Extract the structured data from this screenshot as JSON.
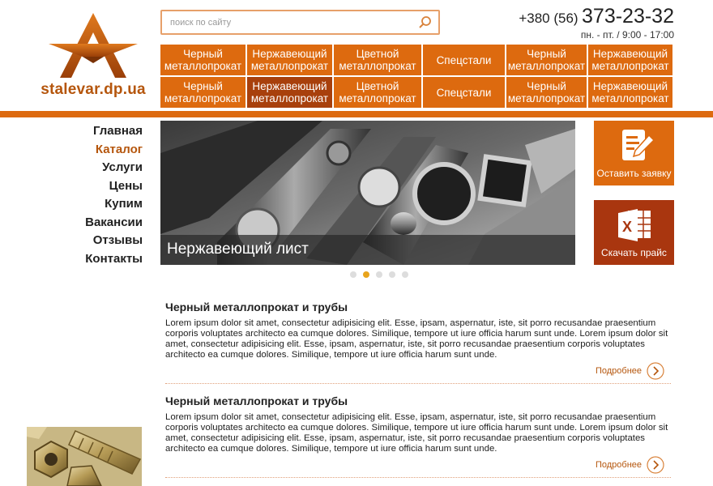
{
  "logo": {
    "text": "stalevar.dp.ua"
  },
  "search": {
    "placeholder": "поиск по сайту"
  },
  "contact": {
    "code": "+380 (56)",
    "number": "373-23-32",
    "hours": "пн. - пт. / 9:00 - 17:00"
  },
  "topnav": {
    "row1": [
      "Черный металлопрокат",
      "Нержавеющий металлопрокат",
      "Цветной металлопрокат",
      "Спецстали",
      "Черный металлопрокат",
      "Нержавеющий металлопрокат"
    ],
    "row2": [
      "Черный металлопрокат",
      "Нержавеющий металлопрокат",
      "Цветной металлопрокат",
      "Спецстали",
      "Черный металлопрокат",
      "Нержавеющий металлопрокат"
    ],
    "active_row2_index": 1
  },
  "sidenav": {
    "items": [
      "Главная",
      "Каталог",
      "Услуги",
      "Цены",
      "Купим",
      "Вакансии",
      "Отзывы",
      "Контакты"
    ],
    "active_index": 1
  },
  "slider": {
    "caption": "Нержавеющий лист",
    "slide_count": 5,
    "active_index": 1
  },
  "actions": {
    "request_label": "Оставить заявку",
    "price_label": "Скачать прайс"
  },
  "articles": [
    {
      "title": "Черный металлопрокат и трубы",
      "text": "Lorem ipsum dolor sit amet, consectetur adipisicing elit. Esse, ipsam, aspernatur, iste, sit porro recusandae praesentium corporis voluptates architecto ea cumque dolores. Similique, tempore ut iure officia harum sunt unde. Lorem ipsum dolor sit amet, consectetur adipisicing elit. Esse, ipsam, aspernatur, iste, sit porro recusandae praesentium corporis voluptates architecto ea cumque dolores. Similique, tempore ut iure officia harum sunt unde.",
      "more": "Подробнее"
    },
    {
      "title": "Черный металлопрокат и трубы",
      "text": "Lorem ipsum dolor sit amet, consectetur adipisicing elit. Esse, ipsam, aspernatur, iste, sit porro recusandae praesentium corporis voluptates architecto ea cumque dolores. Similique, tempore ut iure officia harum sunt unde. Lorem ipsum dolor sit amet, consectetur adipisicing elit. Esse, ipsam, aspernatur, iste, sit porro recusandae praesentium corporis voluptates architecto ea cumque dolores. Similique, tempore ut iure officia harum sunt unde.",
      "more": "Подробнее"
    }
  ],
  "colors": {
    "accent": "#dd6a0f",
    "accent_dark": "#a8400c",
    "brand_text": "#b5560d",
    "dot_active": "#e8a41c"
  },
  "icons": {
    "logo": "star-a-logo-icon",
    "search": "search-icon",
    "request": "document-edit-icon",
    "price": "excel-icon",
    "more": "chevron-right-circle-icon"
  }
}
